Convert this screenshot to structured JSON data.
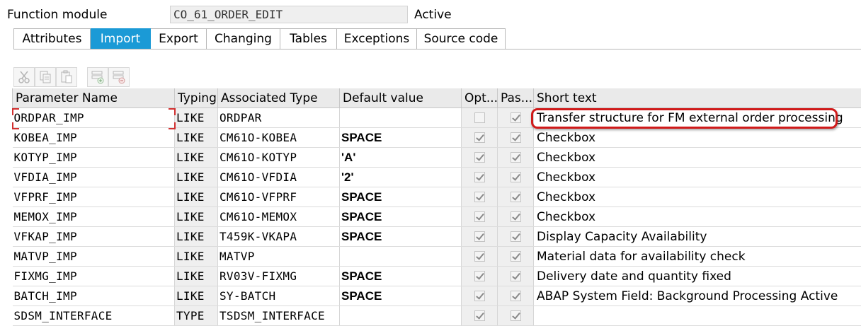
{
  "header": {
    "label": "Function module",
    "name": "CO_61_ORDER_EDIT",
    "status": "Active"
  },
  "tabs": [
    {
      "label": "Attributes",
      "active": false
    },
    {
      "label": "Import",
      "active": true
    },
    {
      "label": "Export",
      "active": false
    },
    {
      "label": "Changing",
      "active": false
    },
    {
      "label": "Tables",
      "active": false
    },
    {
      "label": "Exceptions",
      "active": false
    },
    {
      "label": "Source code",
      "active": false
    }
  ],
  "toolbar": {
    "buttons": [
      "cut-icon",
      "copy-icon",
      "paste-icon",
      "insert-row-icon",
      "delete-row-icon"
    ]
  },
  "colors": {
    "active_tab": "#1b9ad6",
    "highlight": "#d01a1a"
  },
  "table": {
    "columns": [
      "Parameter Name",
      "Typing",
      "Associated Type",
      "Default value",
      "Opt...",
      "Pas...",
      "Short text"
    ],
    "rows": [
      {
        "name": "ORDPAR_IMP",
        "typing": "LIKE",
        "type": "ORDPAR",
        "default": "",
        "optional": false,
        "pass": true,
        "text": "Transfer structure for FM external order processing"
      },
      {
        "name": "KOBEA_IMP",
        "typing": "LIKE",
        "type": "CM61O-KOBEA",
        "default": "SPACE",
        "optional": true,
        "pass": true,
        "text": "Checkbox"
      },
      {
        "name": "KOTYP_IMP",
        "typing": "LIKE",
        "type": "CM61O-KOTYP",
        "default": "'A'",
        "optional": true,
        "pass": true,
        "text": "Checkbox"
      },
      {
        "name": "VFDIA_IMP",
        "typing": "LIKE",
        "type": "CM61O-VFDIA",
        "default": "'2'",
        "optional": true,
        "pass": true,
        "text": "Checkbox"
      },
      {
        "name": "VFPRF_IMP",
        "typing": "LIKE",
        "type": "CM61O-VFPRF",
        "default": "SPACE",
        "optional": true,
        "pass": true,
        "text": "Checkbox"
      },
      {
        "name": "MEMOX_IMP",
        "typing": "LIKE",
        "type": "CM61O-MEMOX",
        "default": "SPACE",
        "optional": true,
        "pass": true,
        "text": "Checkbox"
      },
      {
        "name": "VFKAP_IMP",
        "typing": "LIKE",
        "type": "T459K-VKAPA",
        "default": "SPACE",
        "optional": true,
        "pass": true,
        "text": "Display Capacity Availability"
      },
      {
        "name": "MATVP_IMP",
        "typing": "LIKE",
        "type": "MATVP",
        "default": "",
        "optional": true,
        "pass": true,
        "text": "Material data for availability check"
      },
      {
        "name": "FIXMG_IMP",
        "typing": "LIKE",
        "type": "RV03V-FIXMG",
        "default": "SPACE",
        "optional": true,
        "pass": true,
        "text": "Delivery date and quantity fixed"
      },
      {
        "name": "BATCH_IMP",
        "typing": "LIKE",
        "type": "SY-BATCH",
        "default": "SPACE",
        "optional": true,
        "pass": true,
        "text": "ABAP System Field: Background Processing Active"
      },
      {
        "name": "SDSM_INTERFACE",
        "typing": "TYPE",
        "type": "TSDSM_INTERFACE",
        "default": "",
        "optional": true,
        "pass": true,
        "text": ""
      }
    ]
  }
}
